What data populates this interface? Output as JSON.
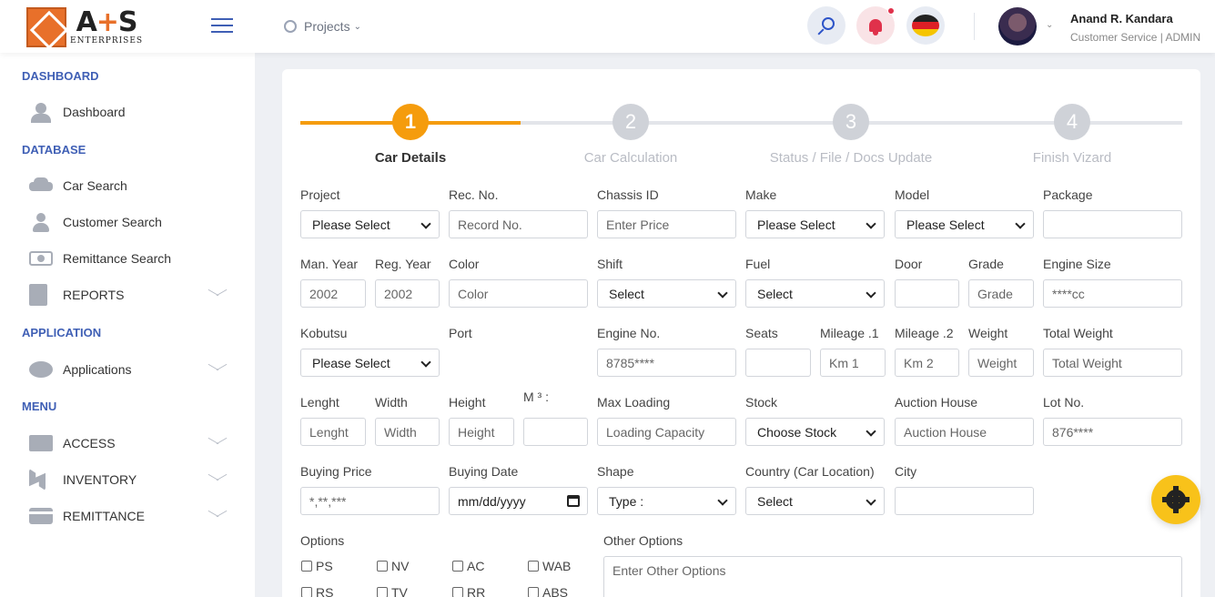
{
  "brand": {
    "logo_text_main": "A",
    "logo_text_plus": "+",
    "logo_text_end": "S",
    "logo_sub": "ENTERPRISES"
  },
  "header": {
    "projects_label": "Projects",
    "user_name": "Anand R. Kandara",
    "user_role": "Customer Service | ADMIN"
  },
  "colors": {
    "accent": "#f59c0d",
    "brand_blue": "#3f5fb5",
    "notification": "#e0314b",
    "fab": "#f8c21a"
  },
  "sidebar": {
    "sections": [
      "DASHBOARD",
      "DATABASE",
      "APPLICATION",
      "MENU"
    ],
    "items": [
      {
        "label": "Dashboard",
        "icon": "people-icon"
      },
      {
        "label": "Car Search",
        "icon": "car-icon"
      },
      {
        "label": "Customer Search",
        "icon": "user-icon"
      },
      {
        "label": "Remittance Search",
        "icon": "money-icon"
      },
      {
        "label": "REPORTS",
        "icon": "document-icon"
      },
      {
        "label": "Applications",
        "icon": "chat-icon"
      },
      {
        "label": "ACCESS",
        "icon": "monitor-icon"
      },
      {
        "label": "INVENTORY",
        "icon": "inventory-icon"
      },
      {
        "label": "REMITTANCE",
        "icon": "card-icon"
      }
    ]
  },
  "wizard": {
    "steps": [
      {
        "num": "1",
        "label": "Car Details"
      },
      {
        "num": "2",
        "label": "Car Calculation"
      },
      {
        "num": "3",
        "label": "Status / File / Docs Update"
      },
      {
        "num": "4",
        "label": "Finish Vizard"
      }
    ],
    "active_step": 1
  },
  "form": {
    "labels": {
      "project": "Project",
      "rec_no": "Rec. No.",
      "chassis": "Chassis ID",
      "make": "Make",
      "model": "Model",
      "package": "Package",
      "man_year": "Man. Year",
      "reg_year": "Reg. Year",
      "color": "Color",
      "shift": "Shift",
      "fuel": "Fuel",
      "door": "Door",
      "grade": "Grade",
      "engine_size": "Engine Size",
      "kobutsu": "Kobutsu",
      "port": "Port",
      "engine_no": "Engine No.",
      "seats": "Seats",
      "mileage1": "Mileage .1",
      "mileage2": "Mileage .2",
      "weight": "Weight",
      "total_weight": "Total Weight",
      "length": "Lenght",
      "width": "Width",
      "height": "Height",
      "m3": "M ³ :",
      "max_loading": "Max Loading",
      "stock": "Stock",
      "auction_house": "Auction House",
      "lot_no": "Lot No.",
      "buying_price": "Buying Price",
      "buying_date": "Buying Date",
      "shape": "Shape",
      "country": "Country (Car Location)",
      "city": "City",
      "options": "Options",
      "other_options": "Other Options"
    },
    "values": {
      "project": "Please Select",
      "rec_no": "Record No.",
      "chassis": "Enter Price",
      "make": "Please Select",
      "model": "Please Select",
      "package": "",
      "man_year": "2002",
      "reg_year": "2002",
      "color": "Color",
      "shift": "Select",
      "fuel": "Select",
      "door": "",
      "grade": "Grade",
      "engine_size": "****cc",
      "kobutsu": "Please Select",
      "engine_no": "8785****",
      "seats": "",
      "mileage1": "Km 1",
      "mileage2": "Km 2",
      "weight": "Weight",
      "total_weight": "Total Weight",
      "length": "Lenght",
      "width": "Width",
      "height": "Height",
      "m3": "",
      "max_loading": "Loading Capacity",
      "stock": "Choose Stock",
      "auction_house": "Auction House",
      "lot_no": "876****",
      "buying_price": "*,**,***",
      "buying_date": "mm/dd/yyyy",
      "shape": "Type :",
      "country": "Select",
      "city": "",
      "other_options": "Enter Other Options"
    },
    "options_checkboxes": [
      "PS",
      "NV",
      "AC",
      "WAB",
      "RS",
      "TV",
      "RR",
      "ABS"
    ]
  }
}
